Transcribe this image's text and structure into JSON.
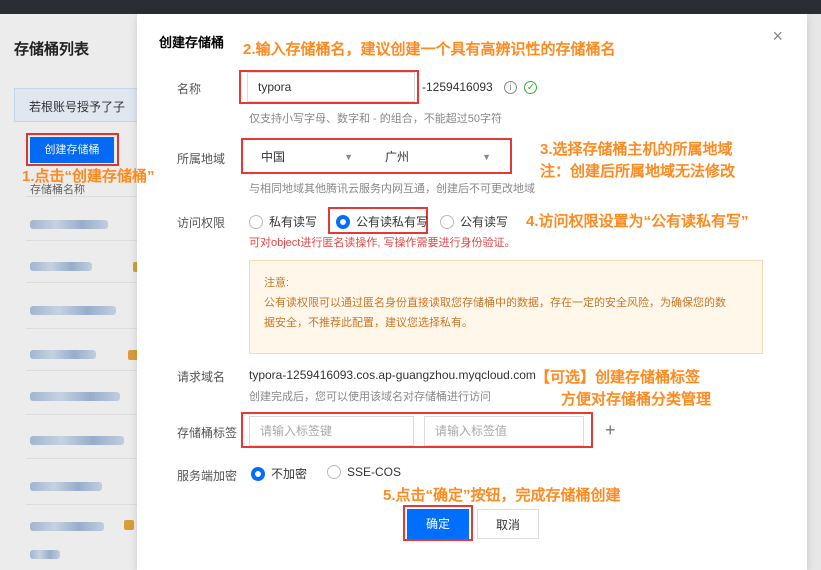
{
  "background": {
    "page_title": "存储桶列表",
    "hint": "若根账号授予了子",
    "create_button": "创建存储桶",
    "column_name": "存储桶名称"
  },
  "annotations": {
    "step1": "1.点击“创建存储桶”",
    "step2": "2.输入存储桶名，建议创建一个具有高辨识性的存储桶名",
    "step3_line1": "3.选择存储桶主机的所属地域",
    "step3_line2": "注：创建后所属地域无法修改",
    "step4": "4.访问权限设置为“公有读私有写”",
    "optional_line1": "【可选】创建存储桶标签",
    "optional_line2": "方便对存储桶分类管理",
    "step5": "5.点击“确定”按钮，完成存储桶创建"
  },
  "modal": {
    "title": "创建存储桶",
    "close_glyph": "×",
    "name": {
      "label": "名称",
      "value": "typora",
      "suffix": "-1259416093",
      "info_glyph": "i",
      "ok_glyph": "✓",
      "help": "仅支持小写字母、数字和 - 的组合，不能超过50字符"
    },
    "region": {
      "label": "所属地域",
      "region_value": "中国",
      "city_value": "广州",
      "chevron": "▼",
      "help": "与相同地域其他腾讯云服务内网互通，创建后不可更改地域"
    },
    "access": {
      "label": "访问权限",
      "options": [
        "私有读写",
        "公有读私有写",
        "公有读写"
      ],
      "selected": "公有读私有写",
      "warning": "可对object进行匿名读操作, 写操作需要进行身份验证。"
    },
    "notice": {
      "title": "注意:",
      "line1": "公有读权限可以通过匿名身份直接读取您存储桶中的数据，存在一定的安全风险，为确保您的数",
      "line2": "据安全，不推荐此配置，建议您选择私有。"
    },
    "domain": {
      "label": "请求域名",
      "value": "typora-1259416093.cos.ap-guangzhou.myqcloud.com",
      "help": "创建完成后，您可以使用该域名对存储桶进行访问"
    },
    "tags": {
      "label": "存储桶标签",
      "key_placeholder": "请输入标签键",
      "value_placeholder": "请输入标签值",
      "add_glyph": "+"
    },
    "encryption": {
      "label": "服务端加密",
      "options": [
        "不加密",
        "SSE-COS"
      ],
      "selected": "不加密"
    },
    "buttons": {
      "ok": "确定",
      "cancel": "取消"
    }
  },
  "colors": {
    "primary": "#006eff",
    "annotation_orange": "#ff8a1f",
    "highlight_red": "#e53935",
    "success_green": "#2db52d"
  }
}
